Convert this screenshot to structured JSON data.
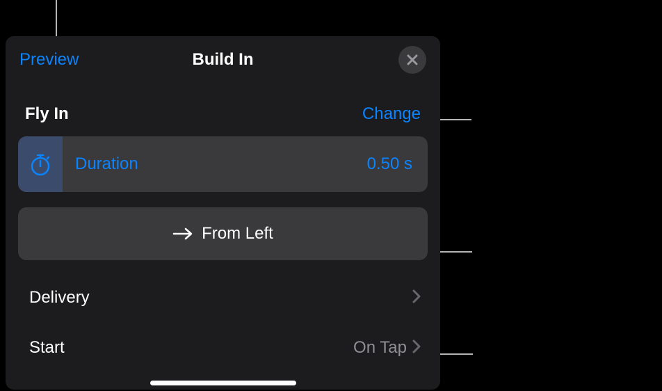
{
  "header": {
    "preview_label": "Preview",
    "title": "Build In"
  },
  "effect": {
    "name": "Fly In",
    "change_label": "Change"
  },
  "duration": {
    "label": "Duration",
    "value": "0.50 s"
  },
  "direction": {
    "label": "From Left"
  },
  "rows": {
    "delivery": {
      "label": "Delivery",
      "value": ""
    },
    "start": {
      "label": "Start",
      "value": "On Tap"
    }
  }
}
